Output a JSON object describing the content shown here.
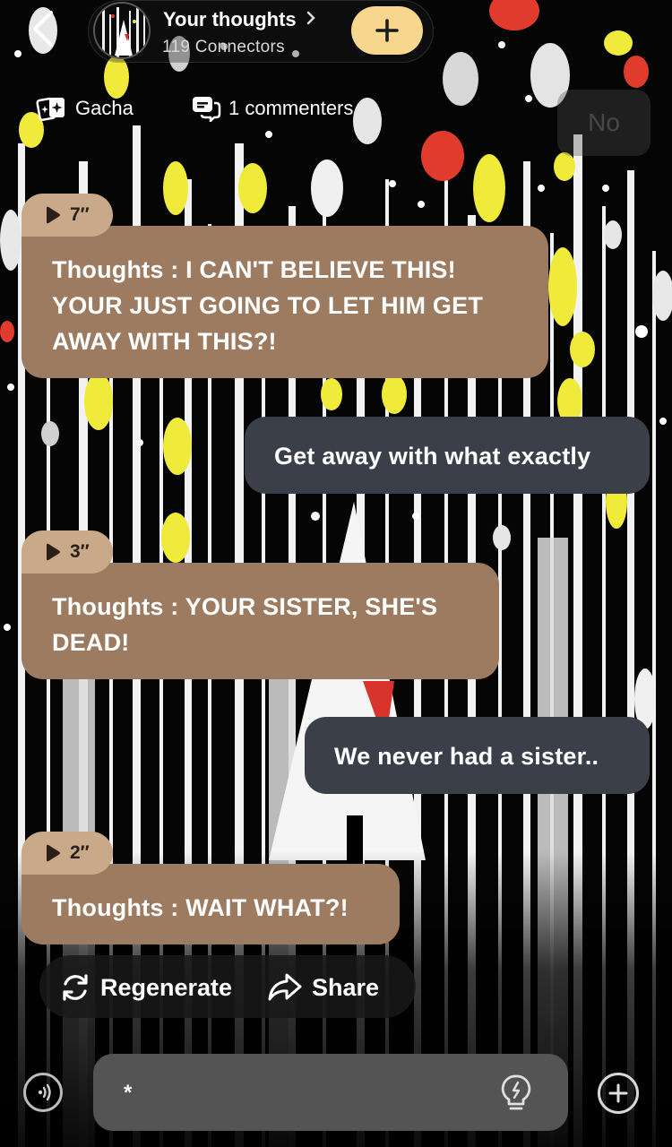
{
  "header": {
    "back_icon": "chevron-left-icon",
    "title": "Your thoughts",
    "title_chevron": "›",
    "subtitle": "119 Connectors",
    "add_icon": "plus-icon"
  },
  "tags": {
    "gacha_label": "Gacha",
    "commenters_label": "1 commenters"
  },
  "ghost_label": "No",
  "messages": [
    {
      "role": "ai",
      "duration": "7″",
      "text": "Thoughts : I CAN'T BELIEVE THIS! YOUR JUST GOING TO LET HIM GET AWAY WITH THIS?!"
    },
    {
      "role": "user",
      "text": "Get away with what exactly"
    },
    {
      "role": "ai",
      "duration": "3″",
      "text": "Thoughts : YOUR SISTER, SHE'S DEAD!"
    },
    {
      "role": "user",
      "text": "We never had a sister.."
    },
    {
      "role": "ai",
      "duration": "2″",
      "text": "Thoughts : WAIT WHAT?!"
    }
  ],
  "actions": {
    "regenerate_label": "Regenerate",
    "share_label": "Share"
  },
  "composer": {
    "input_value": "*",
    "voice_icon": "voice-wave-icon",
    "hint_icon": "lightbulb-icon",
    "plus_icon": "plus-circle-icon"
  },
  "colors": {
    "ai_bubble": "#9d7b60",
    "duration_badge": "#c9a98a",
    "user_bubble": "#3b3f49",
    "add_button": "#f7d78e",
    "input_box": "#545454"
  }
}
